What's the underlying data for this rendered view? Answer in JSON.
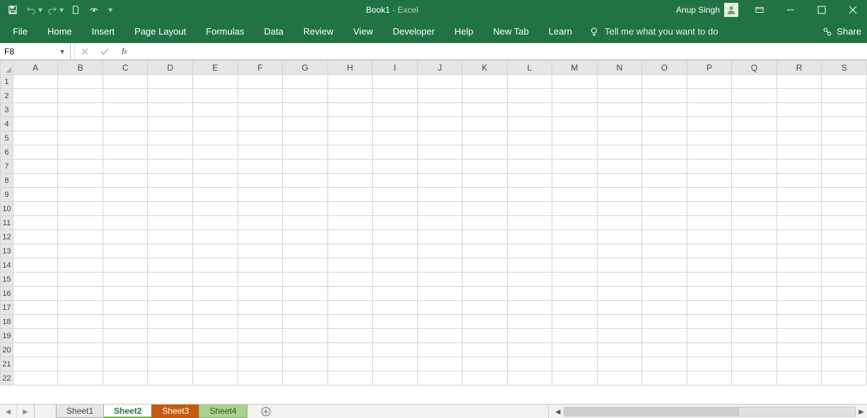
{
  "title": {
    "doc": "Book1",
    "sep": "  -  ",
    "app": "Excel"
  },
  "user": {
    "name": "Anup Singh"
  },
  "ribbon": {
    "tabs": [
      "File",
      "Home",
      "Insert",
      "Page Layout",
      "Formulas",
      "Data",
      "Review",
      "View",
      "Developer",
      "Help",
      "New Tab",
      "Learn"
    ],
    "tellme": "Tell me what you want to do",
    "share": "Share"
  },
  "formula_bar": {
    "name_box": "F8",
    "formula": ""
  },
  "grid": {
    "columns": [
      "A",
      "B",
      "C",
      "D",
      "E",
      "F",
      "G",
      "H",
      "I",
      "J",
      "K",
      "L",
      "M",
      "N",
      "O",
      "P",
      "Q",
      "R",
      "S"
    ],
    "rows": [
      1,
      2,
      3,
      4,
      5,
      6,
      7,
      8,
      9,
      10,
      11,
      12,
      13,
      14,
      15,
      16,
      17,
      18,
      19,
      20,
      21,
      22
    ]
  },
  "sheets": {
    "tabs": [
      {
        "label": "Sheet1",
        "style": "plain"
      },
      {
        "label": "Sheet2",
        "style": "green-bold"
      },
      {
        "label": "Sheet3",
        "style": "orange"
      },
      {
        "label": "Sheet4",
        "style": "lightgreen"
      }
    ]
  }
}
